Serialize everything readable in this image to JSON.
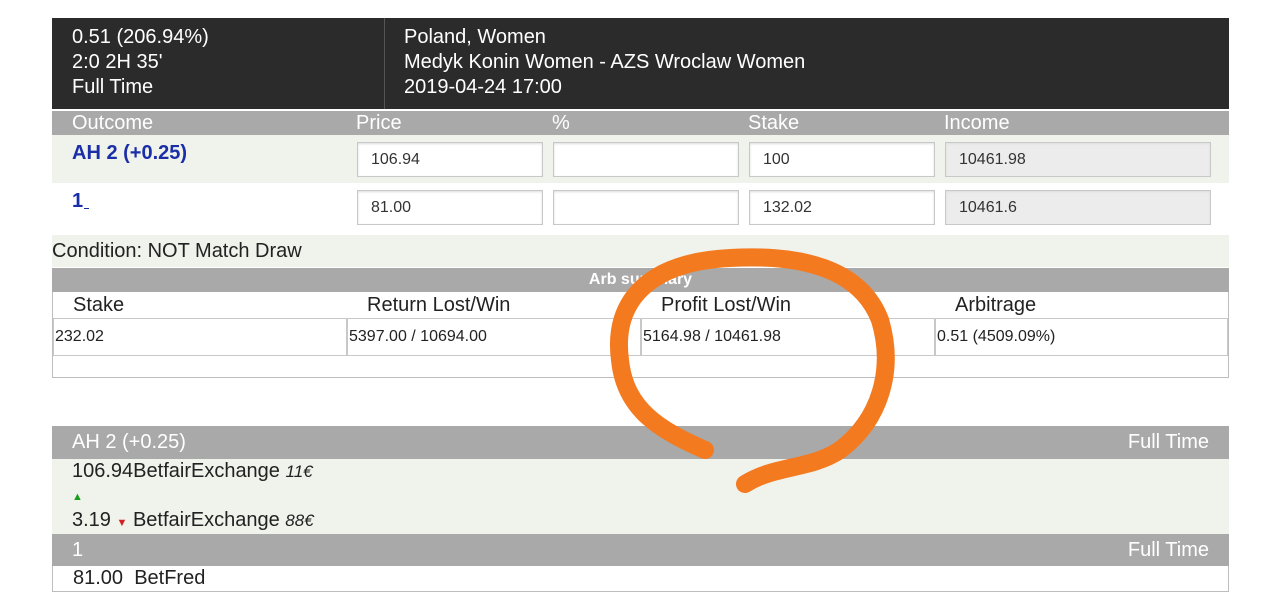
{
  "header": {
    "arb_value": "0.51 (206.94%)",
    "score_time": "2:0 2H 35'",
    "period": "Full Time",
    "league": "Poland, Women",
    "match": "Medyk Konin Women - AZS Wroclaw Women",
    "datetime": "2019-04-24 17:00"
  },
  "table": {
    "columns": [
      "Outcome",
      "Price",
      "%",
      "Stake",
      "Income"
    ],
    "rows": [
      {
        "outcome": "AH 2 (+0.25)",
        "price": "106.94",
        "percent": "",
        "stake": "100",
        "income": "10461.98"
      },
      {
        "outcome": "1",
        "price": "81.00",
        "percent": "",
        "stake": "132.02",
        "income": "10461.6"
      }
    ]
  },
  "condition": "Condition: NOT Match Draw",
  "summary": {
    "title": "Arb summary",
    "labels": [
      "Stake",
      "Return Lost/Win",
      "Profit Lost/Win",
      "Arbitrage"
    ],
    "values": [
      "232.02",
      "5397.00 / 10694.00",
      "5164.98 / 10461.98",
      "0.51 (4509.09%)"
    ]
  },
  "odds": [
    {
      "market": "AH 2 (+0.25)",
      "period": "Full Time",
      "lines": [
        {
          "price": "106.94",
          "bookmaker": "BetfairExchange",
          "amount": "11€",
          "trend": "up"
        },
        {
          "price": "3.19",
          "bookmaker": "BetfairExchange",
          "amount": "88€",
          "trend": "down"
        }
      ]
    },
    {
      "market": "1",
      "period": "Full Time",
      "lines": [
        {
          "price": "81.00",
          "bookmaker": "BetFred"
        }
      ]
    }
  ],
  "colors": {
    "header_bg": "#2b2b2b",
    "bar_gray": "#a9a9a9",
    "outcome_blue": "#1a2ea8",
    "row_tint": "#f0f2ec",
    "annotation_orange": "#f47a20",
    "trend_up": "#1a9d1a",
    "trend_down": "#d42020"
  }
}
